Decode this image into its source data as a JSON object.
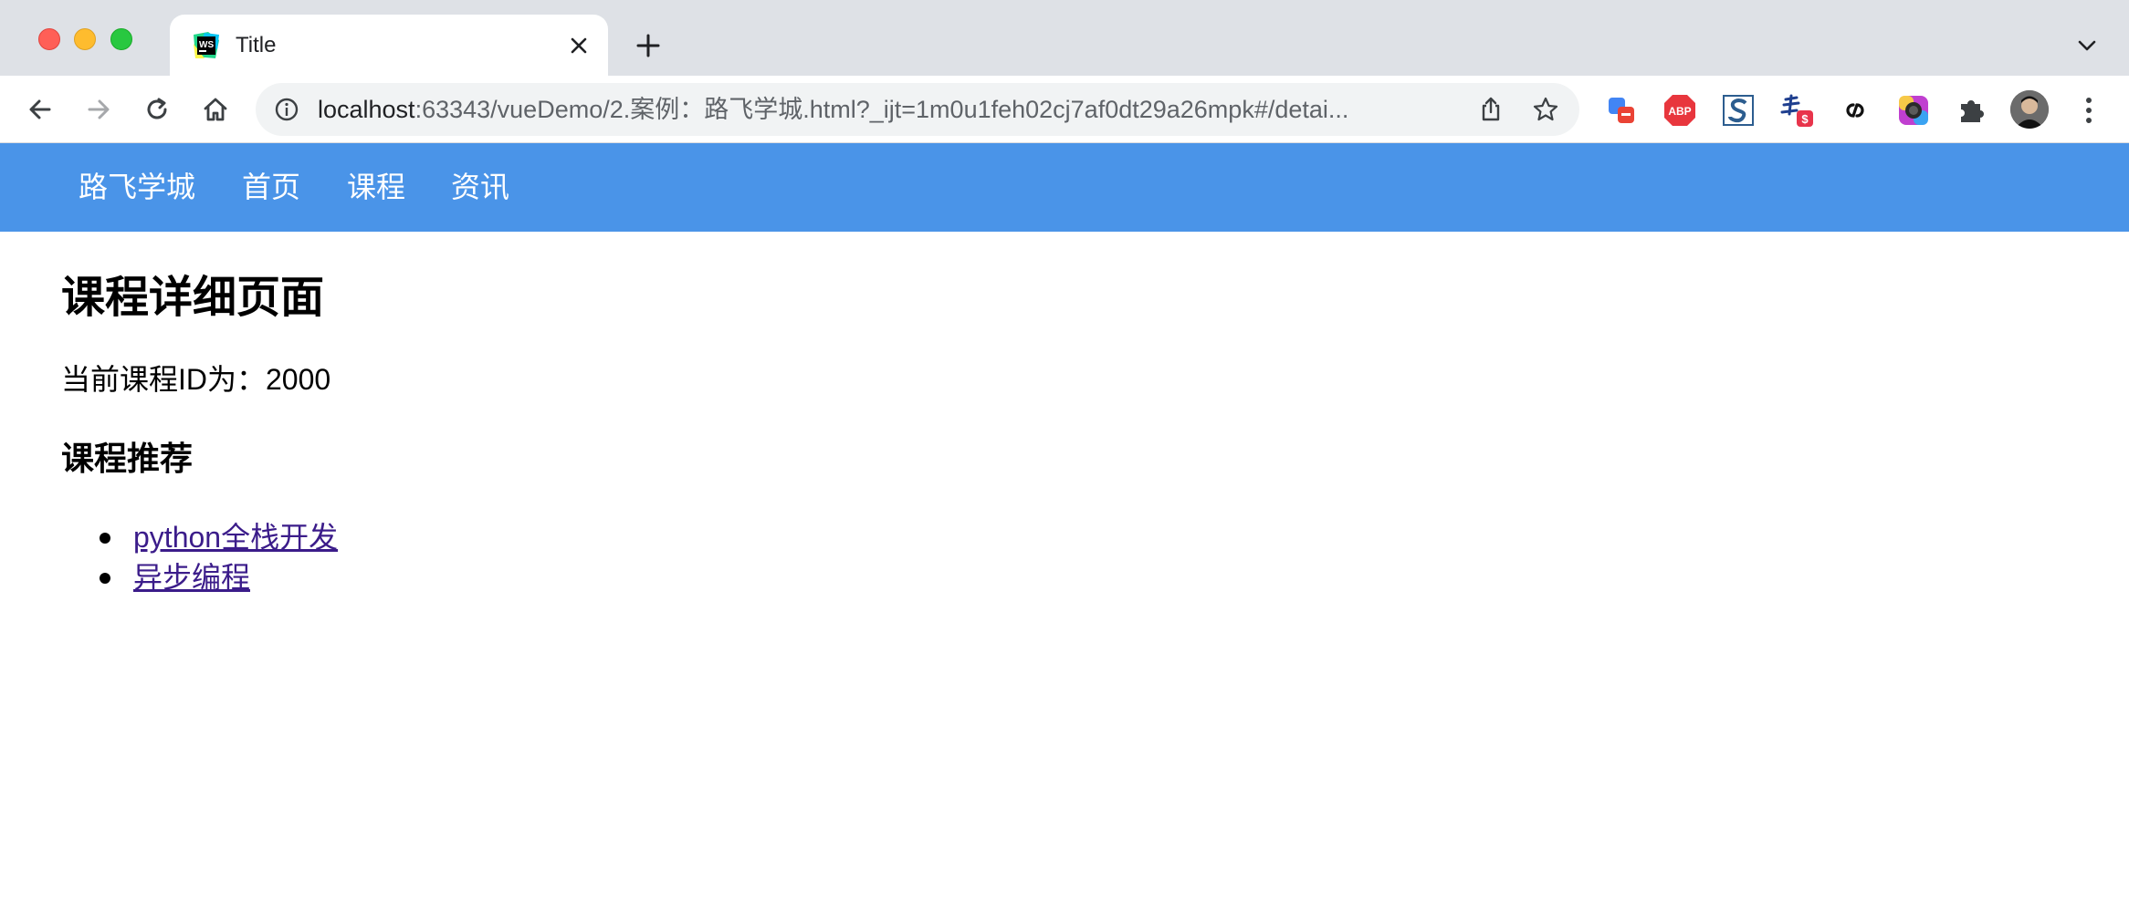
{
  "browser": {
    "tab": {
      "title": "Title"
    },
    "address_bar": {
      "url_host": "localhost",
      "url_rest": ":63343/vueDemo/2.案例：路飞学城.html?_ijt=1m0u1feh02cj7af0dt29a26mpk#/detai..."
    },
    "extensions": {
      "abp_label": "ABP",
      "price_badge": "$"
    }
  },
  "navbar": {
    "brand": "路飞学城",
    "links": [
      "首页",
      "课程",
      "资讯"
    ]
  },
  "main": {
    "heading": "课程详细页面",
    "course_id_text": "当前课程ID为：2000",
    "recommend_heading": "课程推荐",
    "recommendations": [
      "python全栈开发",
      "异步编程"
    ]
  },
  "colors": {
    "navbar_bg": "#4a94e8",
    "visited_link": "#3b1c8a",
    "tabstrip_bg": "#dee1e6"
  }
}
